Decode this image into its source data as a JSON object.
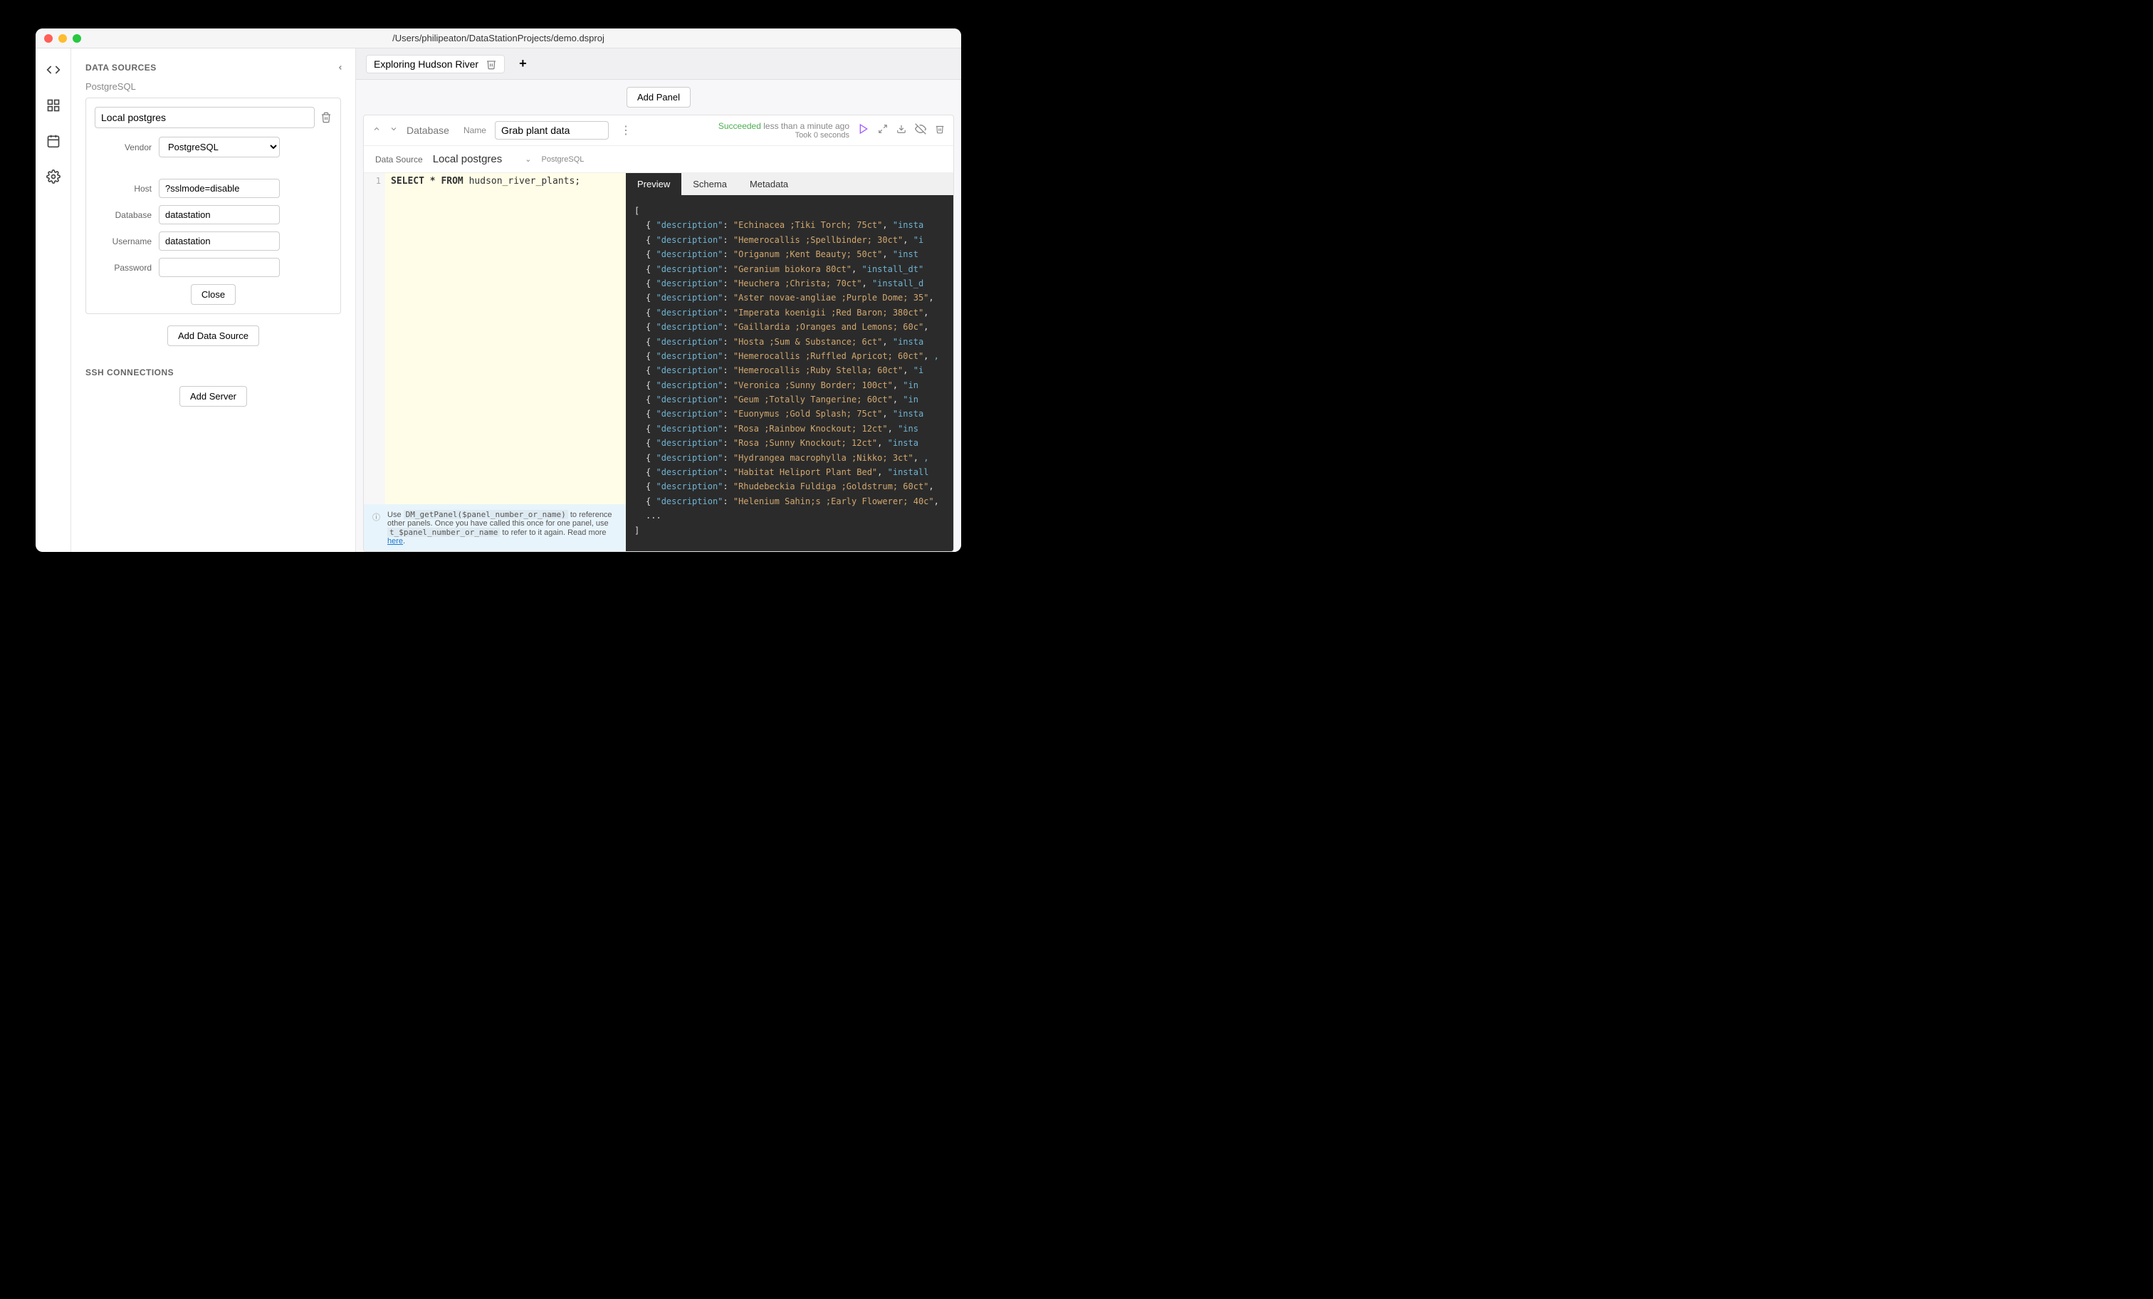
{
  "window": {
    "title": "/Users/philipeaton/DataStationProjects/demo.dsproj"
  },
  "sidebar": {
    "sections": {
      "data_sources": "DATA SOURCES",
      "ssh_connections": "SSH CONNECTIONS"
    },
    "data_source": {
      "vendor_label": "PostgreSQL",
      "name": "Local postgres",
      "fields": {
        "vendor": {
          "label": "Vendor",
          "value": "PostgreSQL"
        },
        "host": {
          "label": "Host",
          "value": "?sslmode=disable"
        },
        "database": {
          "label": "Database",
          "value": "datastation"
        },
        "username": {
          "label": "Username",
          "value": "datastation"
        },
        "password": {
          "label": "Password",
          "value": ""
        }
      },
      "close_label": "Close"
    },
    "add_data_source": "Add Data Source",
    "add_server": "Add Server"
  },
  "tabs": {
    "active": "Exploring Hudson River"
  },
  "add_panel": "Add Panel",
  "panel": {
    "type": "Database",
    "name_label": "Name",
    "name": "Grab plant data",
    "status": {
      "state": "Succeeded",
      "when": "less than a minute ago",
      "duration": "Took 0 seconds"
    },
    "data_source": {
      "label": "Data Source",
      "selected": "Local postgres",
      "vendor": "PostgreSQL"
    },
    "code": {
      "line_no": "1",
      "kw1": "SELECT",
      "star": "*",
      "kw2": "FROM",
      "ident": "hudson_river_plants;"
    },
    "hint": {
      "text_prefix": "Use ",
      "code1": "DM_getPanel($panel_number_or_name)",
      "text_mid": " to reference other panels. Once you have called this once for one panel, use ",
      "code2": "t_$panel_number_or_name",
      "text_suffix": " to refer to it again. Read more ",
      "link": "here",
      "dot": "."
    }
  },
  "results": {
    "tabs": [
      "Preview",
      "Schema",
      "Metadata"
    ],
    "active_tab": "Preview",
    "rows": [
      {
        "description": "Echinacea ;Tiki Torch;  75ct",
        "next": "\"insta"
      },
      {
        "description": "Hemerocallis ;Spellbinder;  30ct",
        "next": "\"i"
      },
      {
        "description": "Origanum ;Kent Beauty;   50ct",
        "next": "\"inst"
      },
      {
        "description": "Geranium biokora  80ct",
        "next": "\"install_dt\""
      },
      {
        "description": "Heuchera ;Christa;   70ct",
        "next": "\"install_d"
      },
      {
        "description": "Aster novae-angliae ;Purple Dome;   35",
        "next": ""
      },
      {
        "description": "Imperata koenigii ;Red Baron;  380ct",
        "next": ""
      },
      {
        "description": "Gaillardia ;Oranges and Lemons;   60c",
        "next": ""
      },
      {
        "description": "Hosta ;Sum & Substance;  6ct",
        "next": "\"insta"
      },
      {
        "description": "Hemerocallis ;Ruffled Apricot; 60ct",
        "next": ","
      },
      {
        "description": "Hemerocallis ;Ruby Stella;  60ct",
        "next": "\"i"
      },
      {
        "description": "Veronica ;Sunny Border;   100ct",
        "next": "\"in"
      },
      {
        "description": "Geum ;Totally Tangerine;   60ct",
        "next": "\"in"
      },
      {
        "description": "Euonymus ;Gold Splash;  75ct",
        "next": "\"insta"
      },
      {
        "description": "Rosa ;Rainbow Knockout;   12ct",
        "next": "\"ins"
      },
      {
        "description": "Rosa ;Sunny Knockout;   12ct",
        "next": "\"insta"
      },
      {
        "description": "Hydrangea macrophylla ;Nikko;   3ct",
        "next": ","
      },
      {
        "description": "Habitat Heliport Plant Bed",
        "next": "\"install"
      },
      {
        "description": "Rhudebeckia Fuldiga ;Goldstrum; 60ct",
        "next": ""
      },
      {
        "description": "Helenium Sahin;s ;Early Flowerer; 40c",
        "next": ""
      }
    ],
    "ellipsis": "..."
  }
}
